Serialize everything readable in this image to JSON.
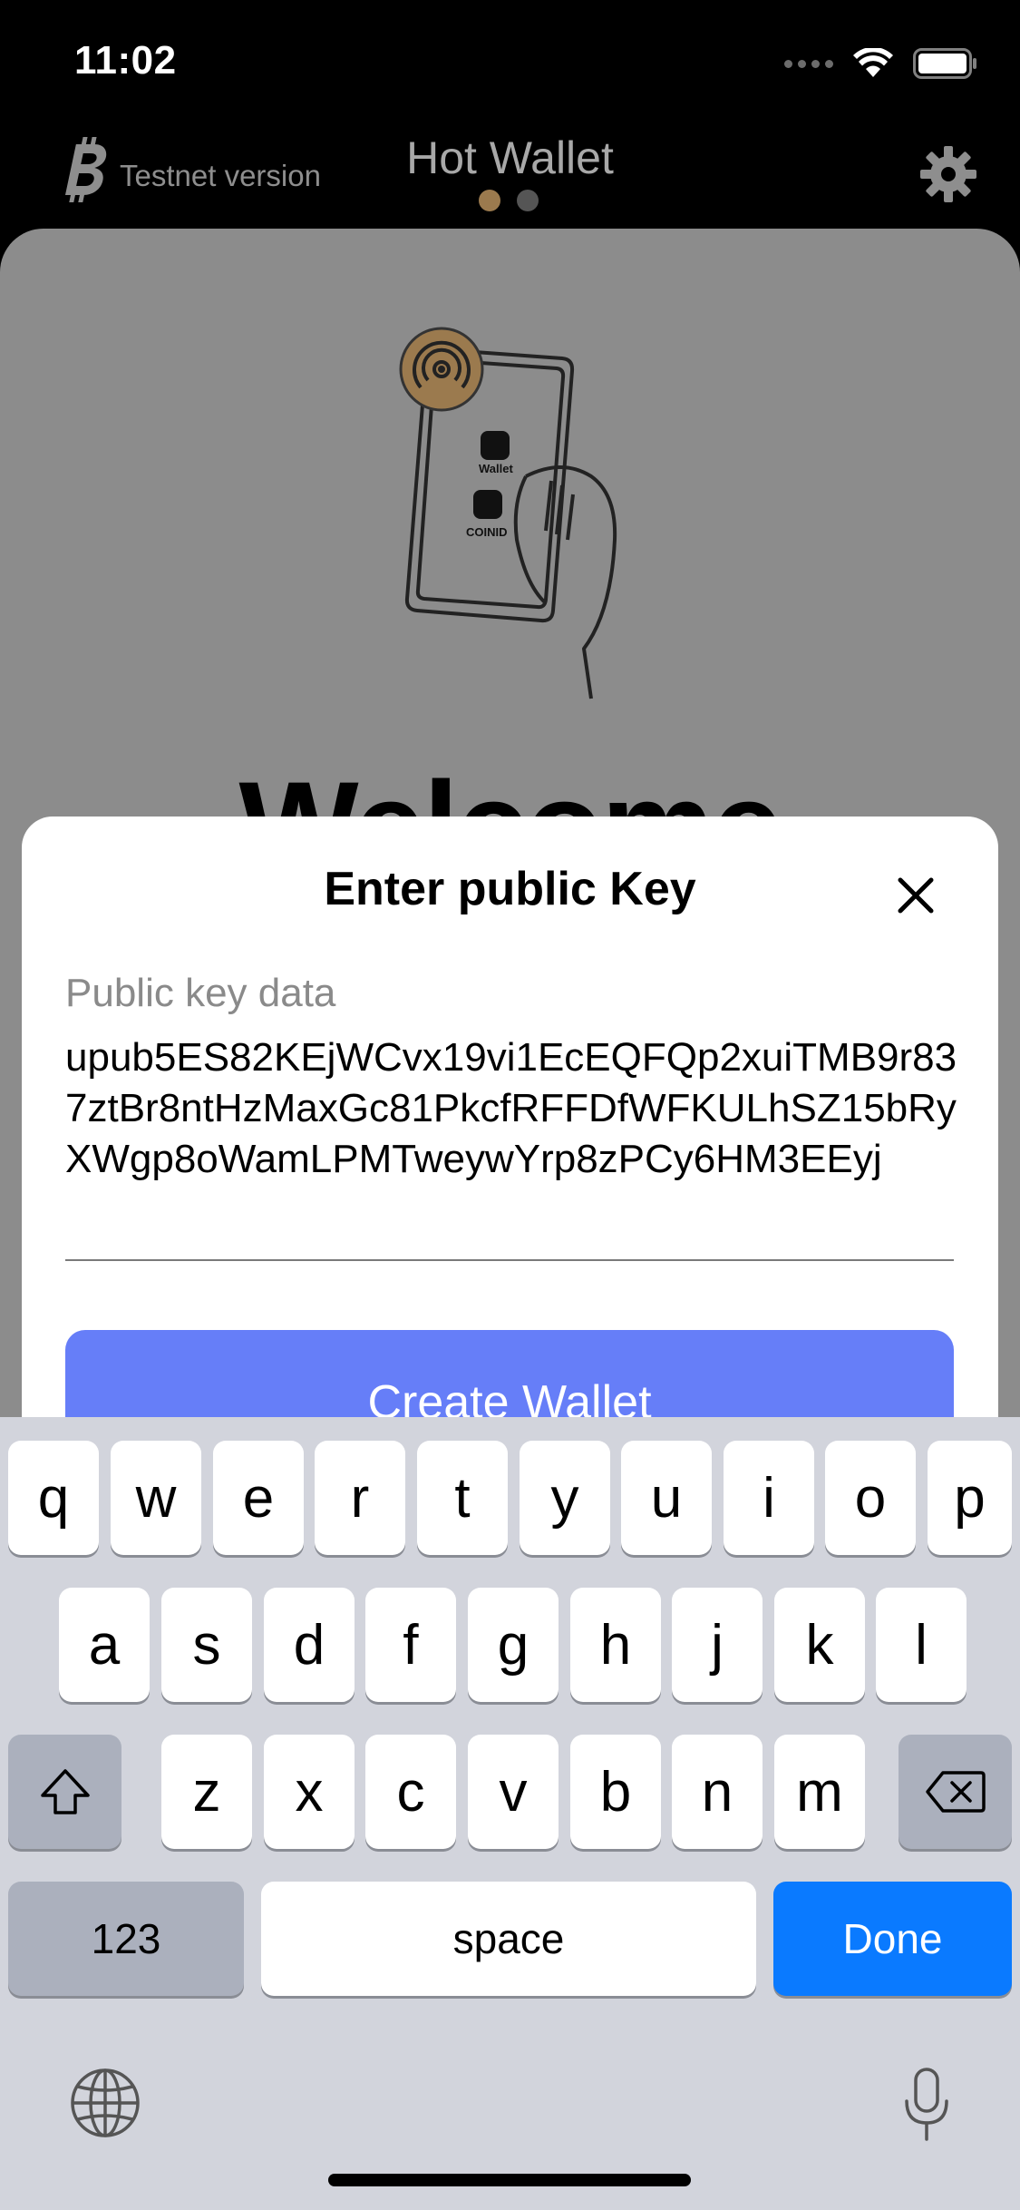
{
  "status": {
    "time": "11:02"
  },
  "header": {
    "network_label": "Testnet version",
    "title": "Hot Wallet",
    "pages": 2,
    "active_page": 0
  },
  "background": {
    "illustration_labels": [
      "Wallet",
      "COINID"
    ],
    "heading": "Welcome"
  },
  "modal": {
    "title": "Enter public Key",
    "field_label": "Public key data",
    "field_value": "upub5ES82KEjWCvx19vi1EcEQFQp2xuiTMB9r837ztBr8ntHzMaxGc81PkcfRFFDfWFKULhSZ15bRyXWgp8oWamLPMTweywYrp8zPCy6HM3EEyj",
    "create_button": "Create Wallet"
  },
  "keyboard": {
    "row1": [
      "q",
      "w",
      "e",
      "r",
      "t",
      "y",
      "u",
      "i",
      "o",
      "p"
    ],
    "row2": [
      "a",
      "s",
      "d",
      "f",
      "g",
      "h",
      "j",
      "k",
      "l"
    ],
    "row3": [
      "z",
      "x",
      "c",
      "v",
      "b",
      "n",
      "m"
    ],
    "numbers_label": "123",
    "space_label": "space",
    "done_label": "Done"
  },
  "colors": {
    "accent_gold": "#9b7a4e",
    "create_button": "#667ef8",
    "done_key": "#0a7aff"
  }
}
